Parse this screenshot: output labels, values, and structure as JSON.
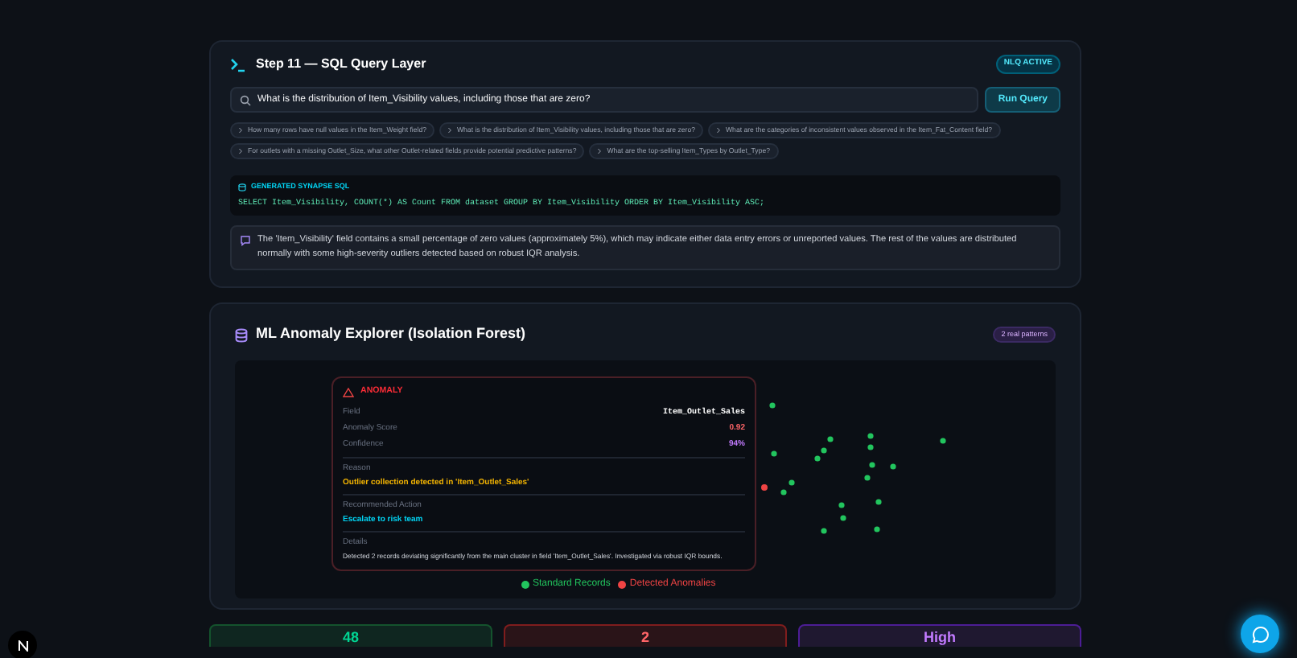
{
  "sql_panel": {
    "title": "Step 11 — SQL Query Layer",
    "badge": "NLQ ACTIVE",
    "query": "What is the distribution of Item_Visibility values, including those that are zero?",
    "run_button": "Run Query",
    "suggestions": [
      "How many rows have null values in the Item_Weight field?",
      "What is the distribution of Item_Visibility values, including those that are zero?",
      "What are the categories of inconsistent values observed in the Item_Fat_Content field?",
      "For outlets with a missing Outlet_Size, what other Outlet-related fields provide potential predictive patterns?",
      "What are the top-selling Item_Types by Outlet_Type?"
    ],
    "sql_label": "GENERATED SYNAPSE SQL",
    "sql": "SELECT Item_Visibility, COUNT(*) AS Count FROM dataset GROUP BY Item_Visibility ORDER BY Item_Visibility ASC;",
    "answer": "The 'Item_Visibility' field contains a small percentage of zero values (approximately 5%), which may indicate either data entry errors or unreported values. The rest of the values are distributed normally with some high-severity outliers detected based on robust IQR analysis."
  },
  "anomaly_panel": {
    "title": "ML Anomaly Explorer (Isolation Forest)",
    "badge": "2 real patterns",
    "tooltip": {
      "heading": "ANOMALY",
      "rows": [
        {
          "label": "Field",
          "value": "Item_Outlet_Sales",
          "kind": "mono"
        },
        {
          "label": "Anomaly Score",
          "value": "0.92",
          "kind": "score"
        },
        {
          "label": "Confidence",
          "value": "94%",
          "kind": "confidence"
        }
      ],
      "reason_label": "Reason",
      "reason": "Outlier collection detected in 'Item_Outlet_Sales'",
      "action_label": "Recommended Action",
      "action": "Escalate to risk team",
      "details_label": "Details",
      "details": "Detected 2 records deviating significantly from the main cluster in field 'Item_Outlet_Sales'. Investigated via robust IQR bounds."
    },
    "legend": [
      {
        "label": "Standard Records",
        "color": "#22c55e"
      },
      {
        "label": "Detected Anomalies",
        "color": "#ef4444"
      }
    ]
  },
  "stats": [
    {
      "value": "48",
      "kind": "normal"
    },
    {
      "value": "2",
      "kind": "anomaly"
    },
    {
      "value": "High",
      "kind": "severity"
    }
  ]
}
